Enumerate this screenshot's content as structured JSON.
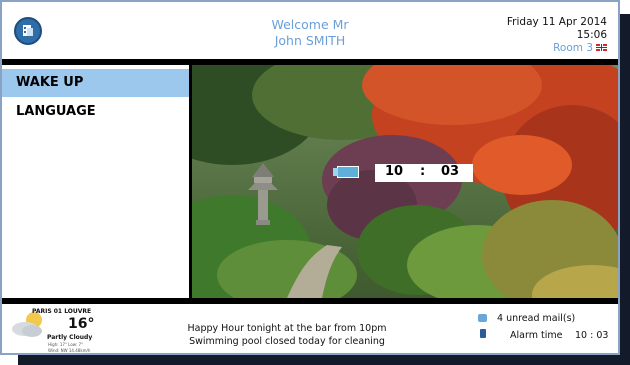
{
  "header": {
    "welcome_line1": "Welcome Mr",
    "welcome_line2": "John SMITH",
    "date": "Friday 11 Apr 2014",
    "time": "15:06",
    "room": "Room 3"
  },
  "menu": {
    "items": [
      {
        "label": "WAKE UP",
        "selected": true
      },
      {
        "label": "LANGUAGE",
        "selected": false
      }
    ]
  },
  "wakeup_clock": {
    "hours": "10",
    "separator": ":",
    "minutes": "03"
  },
  "weather": {
    "city": "PARIS 01 LOUVRE",
    "temperature": "16°",
    "condition": "Partly Cloudy",
    "details": "High: 17° Low: 7°",
    "wind": "Wind: NW 14.48km/h"
  },
  "messages": {
    "line1": "Happy Hour tonight at the bar from 10pm",
    "line2": "Swimming pool closed today for cleaning"
  },
  "status": {
    "mail_text": "4 unread mail(s)",
    "alarm_label": "Alarm time",
    "alarm_value": "10 : 03"
  },
  "colors": {
    "accent": "#6a9fd8",
    "selected": "#9bc8ec",
    "frame": "#8aa3c4",
    "divider": "#000000"
  },
  "icons": {
    "logo": "hotel-logo-icon",
    "flag": "uk-flag-icon",
    "weather": "partly-cloudy-icon",
    "mail": "mail-icon",
    "alarm": "alarm-icon",
    "camera": "camera-icon"
  }
}
